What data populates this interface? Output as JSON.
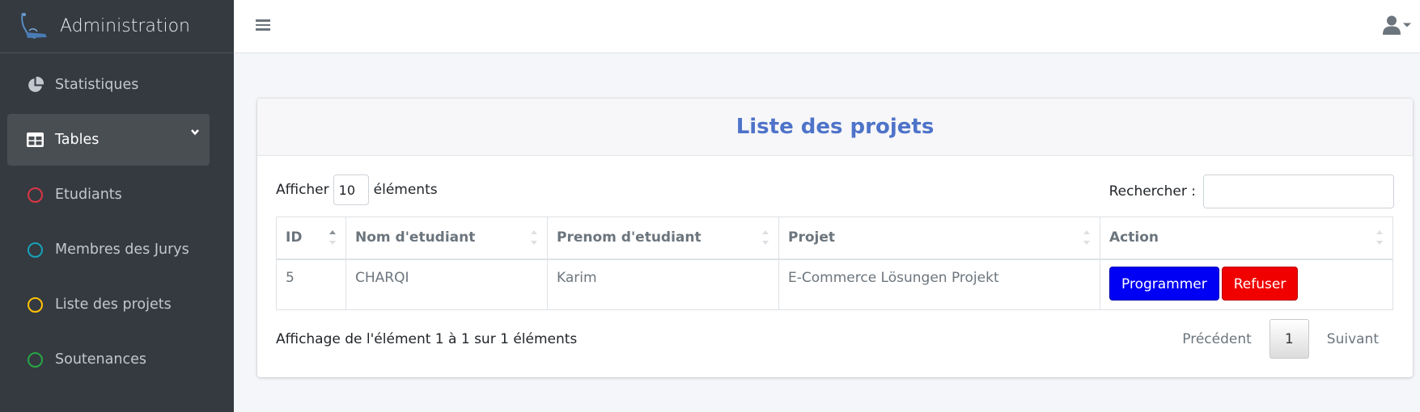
{
  "brand": {
    "title": "Administration"
  },
  "sidebar": {
    "items": [
      {
        "label": "Statistiques",
        "icon": "pie-chart-icon"
      },
      {
        "label": "Tables",
        "icon": "table-icon"
      },
      {
        "label": "Etudiants",
        "icon": "circle-icon",
        "color": "#dc3545"
      },
      {
        "label": "Membres des Jurys",
        "icon": "circle-icon",
        "color": "#17a2b8"
      },
      {
        "label": "Liste des projets",
        "icon": "circle-icon",
        "color": "#ffc107"
      },
      {
        "label": "Soutenances",
        "icon": "circle-icon",
        "color": "#28a745"
      }
    ]
  },
  "card": {
    "title": "Liste des projets"
  },
  "table_controls": {
    "show_prefix": "Afficher",
    "show_value": "10",
    "show_suffix": "éléments",
    "search_label": "Rechercher :",
    "search_value": ""
  },
  "table": {
    "columns": [
      "ID",
      "Nom d'etudiant",
      "Prenom d'etudiant",
      "Projet",
      "Action"
    ],
    "rows": [
      {
        "id": "5",
        "nom": "CHARQI",
        "prenom": "Karim",
        "projet": "E-Commerce Lösungen Projekt"
      }
    ],
    "actions": {
      "primary": "Programmer",
      "danger": "Refuser"
    }
  },
  "footer": {
    "info": "Affichage de l'élément 1 à 1 sur 1 éléments",
    "prev": "Précédent",
    "current_page": "1",
    "next": "Suivant"
  },
  "colors": {
    "sidebar_bg": "#343a40",
    "title": "#4e73c9",
    "primary_button": "#0000f4",
    "danger_button": "#f10000"
  }
}
